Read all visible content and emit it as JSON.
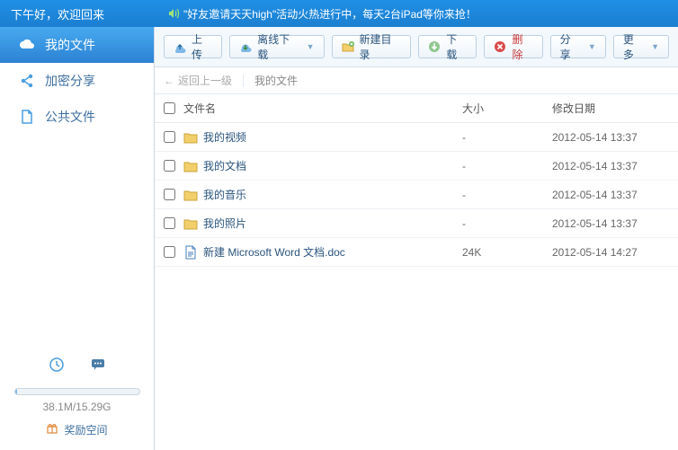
{
  "banner": {
    "greeting": "下午好，欢迎回来",
    "announcement": "\"好友邀请天天high\"活动火热进行中，每天2台iPad等你来抢！"
  },
  "sidebar": {
    "items": [
      {
        "label": "我的文件"
      },
      {
        "label": "加密分享"
      },
      {
        "label": "公共文件"
      }
    ],
    "quota": {
      "text": "38.1M/15.29G"
    },
    "bonus_label": "奖励空间"
  },
  "toolbar": {
    "upload": "上传",
    "offline": "离线下载",
    "newdir": "新建目录",
    "download": "下载",
    "delete": "删除",
    "share": "分享",
    "more": "更多"
  },
  "crumbs": {
    "back": "返回上一级",
    "current": "我的文件"
  },
  "columns": {
    "name": "文件名",
    "size": "大小",
    "date": "修改日期"
  },
  "files": [
    {
      "name": "我的视频",
      "size": "-",
      "date": "2012-05-14 13:37",
      "kind": "folder"
    },
    {
      "name": "我的文档",
      "size": "-",
      "date": "2012-05-14 13:37",
      "kind": "folder"
    },
    {
      "name": "我的音乐",
      "size": "-",
      "date": "2012-05-14 13:37",
      "kind": "folder"
    },
    {
      "name": "我的照片",
      "size": "-",
      "date": "2012-05-14 13:37",
      "kind": "folder"
    },
    {
      "name": "新建 Microsoft Word 文档.doc",
      "size": "24K",
      "date": "2012-05-14 14:27",
      "kind": "doc"
    }
  ]
}
